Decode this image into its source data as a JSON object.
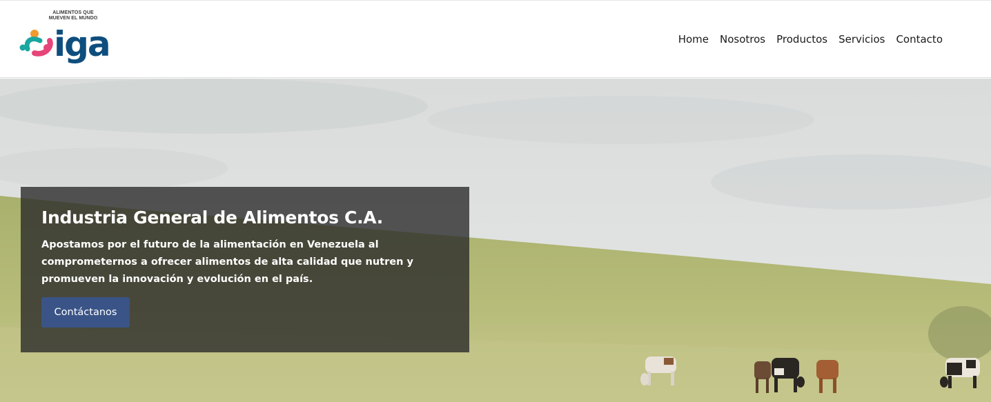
{
  "logo": {
    "tagline_line1": "ALIMENTOS QUE",
    "tagline_line2": "MUEVEN EL MUNDO",
    "wordmark": "iga",
    "colors": {
      "teal": "#1aa6a0",
      "orange": "#f29a2e",
      "pink": "#e6457a",
      "navy": "#0e4e7e"
    }
  },
  "nav": {
    "items": [
      "Home",
      "Nosotros",
      "Productos",
      "Servicios",
      "Contacto"
    ]
  },
  "hero": {
    "title": "Industria General de Alimentos C.A.",
    "description": "Apostamos por el futuro de la alimentación en Venezuela al comprometernos a ofrecer alimentos de alta calidad que nutren y promueven la innovación y evolución en el país.",
    "cta_label": "Contáctanos",
    "cta_color": "#3a5487"
  }
}
